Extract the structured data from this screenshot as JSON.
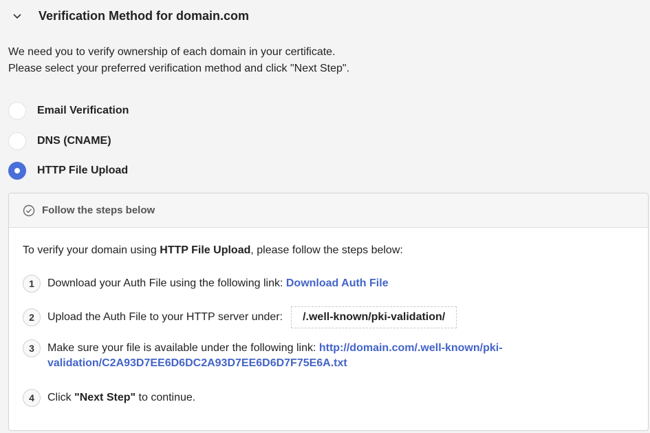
{
  "header": {
    "title": "Verification Method for domain.com",
    "chevron_icon": "chevron-down-icon"
  },
  "intro": {
    "line1": "We need you to verify ownership of each domain in your certificate.",
    "line2": "Please select your preferred verification method and click \"Next Step\"."
  },
  "methods": [
    {
      "label": "Email Verification",
      "selected": false
    },
    {
      "label": "DNS (CNAME)",
      "selected": false
    },
    {
      "label": "HTTP File Upload",
      "selected": true
    }
  ],
  "panel": {
    "title": "Follow the steps below",
    "icon": "check-circle-icon",
    "lead_prefix": "To verify your domain using ",
    "lead_bold": "HTTP File Upload",
    "lead_suffix": ", please follow the steps below:",
    "steps": [
      {
        "num": "1",
        "text": "Download your Auth File using the following link: ",
        "link": "Download Auth File"
      },
      {
        "num": "2",
        "text": "Upload the Auth File to your HTTP server under:",
        "path": "/.well-known/pki-validation/"
      },
      {
        "num": "3",
        "text": "Make sure your file is available under the following link: ",
        "link_line1": "http://domain.com/.well-known/pki-",
        "link_line2": "validation/C2A93D7EE6D6DC2A93D7EE6D6D7F75E6A.txt"
      },
      {
        "num": "4",
        "text_before": "Click ",
        "text_bold": "\"Next Step\"",
        "text_after": " to continue."
      }
    ]
  },
  "colors": {
    "accent": "#4a6fd8",
    "link": "#4364c8"
  }
}
